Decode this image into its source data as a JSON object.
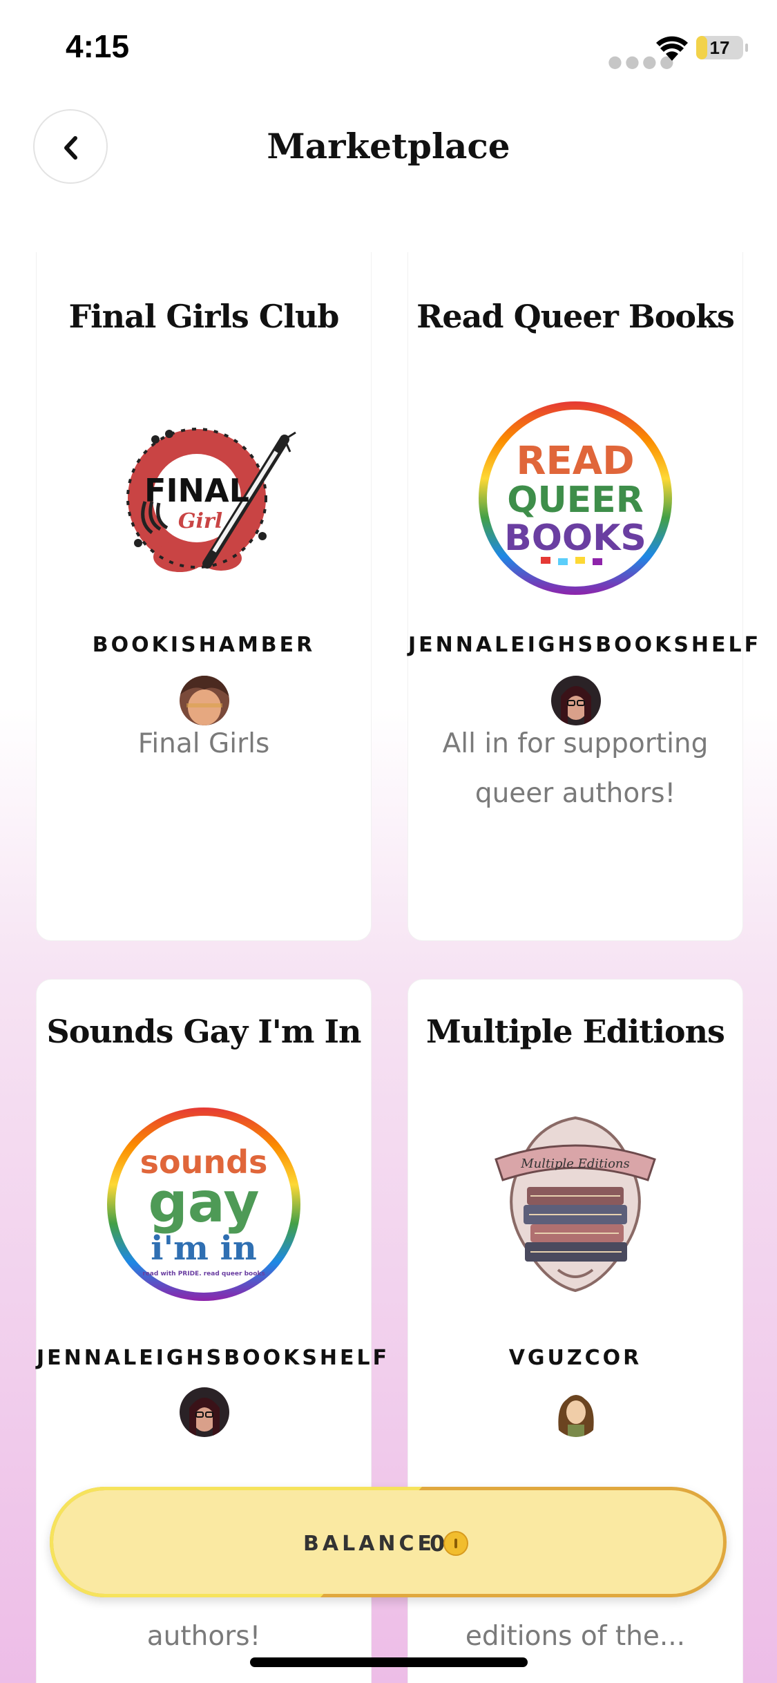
{
  "status_bar": {
    "time": "4:15",
    "battery_level": "17",
    "battery_fraction": 0.17
  },
  "header": {
    "title": "Marketplace"
  },
  "cards": [
    {
      "title": "Final Girls Club",
      "owner": "BOOKISHAMBER",
      "description": "Final Girls",
      "logo_icon": "final-girl-logo",
      "logo_text": [
        "FINAL",
        "Girl"
      ]
    },
    {
      "title": "Read Queer Books",
      "owner": "JENNALEIGHSBOOKSHELF",
      "description": "All in for supporting queer authors!",
      "logo_icon": "read-queer-books-logo",
      "logo_text": [
        "READ",
        "QUEER",
        "BOOKS"
      ]
    },
    {
      "title": "Sounds Gay I'm In",
      "owner": "JENNALEIGHSBOOKSHELF",
      "description": "authors!",
      "logo_icon": "sounds-gay-im-in-logo",
      "logo_text": [
        "sounds",
        "gay",
        "i'm in",
        "read with PRIDE. read queer books"
      ]
    },
    {
      "title": "Multiple Editions",
      "owner": "VGUZCOR",
      "description": "editions of the...",
      "logo_icon": "multiple-editions-logo",
      "logo_text": [
        "Multiple Editions"
      ]
    }
  ],
  "balance": {
    "label": "BALANCE",
    "value": "0",
    "icon": "coin-icon"
  },
  "colors": {
    "balance_bg": "#fae9a2",
    "balance_border": "#e0a83e",
    "gradient_bottom": "#edbde7"
  }
}
